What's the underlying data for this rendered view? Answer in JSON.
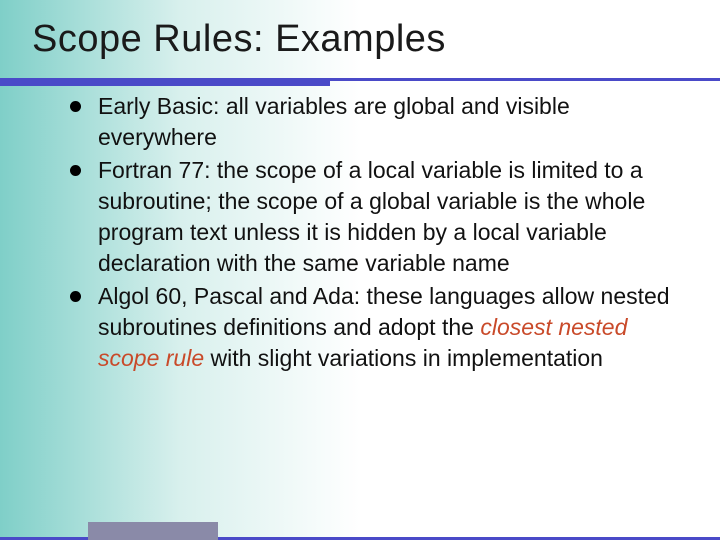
{
  "title": "Scope Rules: Examples",
  "bullets": [
    {
      "prefix": "Early Basic: ",
      "body": "all variables are global and visible everywhere"
    },
    {
      "prefix": "Fortran 77: ",
      "body": "the scope of a local variable is limited to a subroutine; the scope of a global variable is the whole program text unless it is hidden by a local variable declaration with the same variable name"
    },
    {
      "prefix": "Algol 60, Pascal and Ada: ",
      "body_pre": "these languages allow nested subroutines definitions and adopt the ",
      "emph": "closest nested scope rule",
      "body_post": " with slight variations in implementation"
    }
  ]
}
